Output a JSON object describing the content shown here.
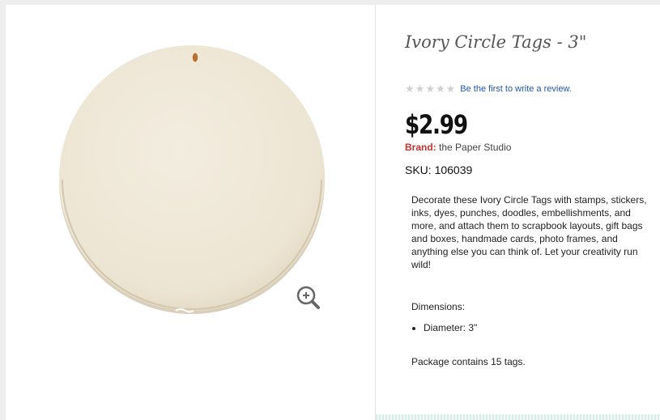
{
  "product": {
    "title": "Ivory Circle Tags - 3\"",
    "rating": {
      "stars_filled": 0,
      "stars_total": 5,
      "review_link": "Be the first to write a review."
    },
    "price": "$2.99",
    "brand_label": "Brand:",
    "brand_value": "the Paper Studio",
    "sku_label": "SKU:",
    "sku_value": "106039",
    "description": "Decorate these Ivory Circle Tags with stamps, stickers, inks, dyes, punches, doodles, embellishments, and more, and attach them to scrapbook layouts, gift bags and boxes, handmade cards, photo frames, and anything else you can think of. Let your creativity run wild!",
    "dimensions_label": "Dimensions:",
    "dimensions": [
      "Diameter: 3\""
    ],
    "package": "Package contains 15 tags."
  },
  "icons": {
    "zoom": "zoom-in-icon",
    "star": "star-icon"
  },
  "colors": {
    "brand_label": "#c8322b",
    "review_link": "#1f57b8",
    "star_empty": "#d0d0d0",
    "tag_fill": "#efe8d8"
  }
}
